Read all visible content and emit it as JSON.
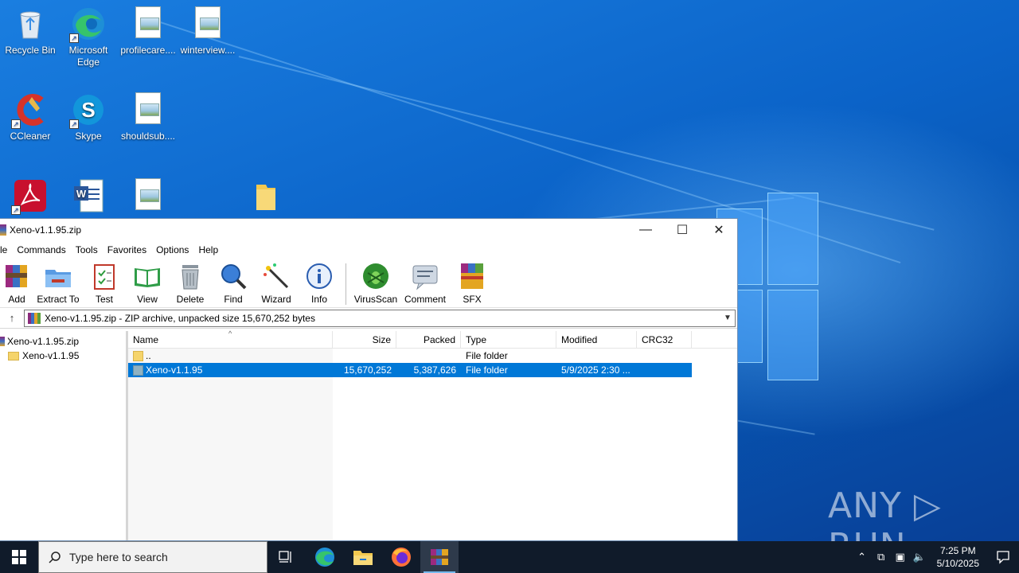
{
  "desktop": {
    "icons": [
      {
        "label": "Recycle Bin"
      },
      {
        "label": "Microsoft Edge"
      },
      {
        "label": "profilecare...."
      },
      {
        "label": "winterview...."
      },
      {
        "label": "CCleaner"
      },
      {
        "label": "Skype"
      },
      {
        "label": "shouldsub...."
      }
    ],
    "watermark": "ANY ▷ RUN"
  },
  "window": {
    "title": "Xeno-v1.1.95.zip",
    "controls": {
      "minimize": "—",
      "maximize": "☐",
      "close": "✕"
    },
    "menu": [
      "le",
      "Commands",
      "Tools",
      "Favorites",
      "Options",
      "Help"
    ],
    "toolbar": [
      {
        "label": "Add",
        "icon": "add-archive-icon"
      },
      {
        "label": "Extract To",
        "icon": "extract-folder-icon"
      },
      {
        "label": "Test",
        "icon": "test-clipboard-icon"
      },
      {
        "label": "View",
        "icon": "view-book-icon"
      },
      {
        "label": "Delete",
        "icon": "trash-icon"
      },
      {
        "label": "Find",
        "icon": "magnifier-icon"
      },
      {
        "label": "Wizard",
        "icon": "magic-wand-icon"
      },
      {
        "label": "Info",
        "icon": "info-icon"
      },
      {
        "label": "VirusScan",
        "icon": "virus-scan-icon"
      },
      {
        "label": "Comment",
        "icon": "comment-icon"
      },
      {
        "label": "SFX",
        "icon": "sfx-box-icon"
      }
    ],
    "address": "Xeno-v1.1.95.zip - ZIP archive, unpacked size 15,670,252 bytes",
    "tree": [
      {
        "label": "Xeno-v1.1.95.zip"
      },
      {
        "label": "Xeno-v1.1.95"
      }
    ],
    "columns": [
      "Name",
      "Size",
      "Packed",
      "Type",
      "Modified",
      "CRC32"
    ],
    "rows": [
      {
        "name": "..",
        "size": "",
        "packed": "",
        "type": "File folder",
        "modified": "",
        "crc": "",
        "selected": false
      },
      {
        "name": "Xeno-v1.1.95",
        "size": "15,670,252",
        "packed": "5,387,626",
        "type": "File folder",
        "modified": "5/9/2025 2:30 ...",
        "crc": "",
        "selected": true
      }
    ]
  },
  "taskbar": {
    "search_placeholder": "Type here to search",
    "time": "7:25 PM",
    "date": "5/10/2025"
  }
}
